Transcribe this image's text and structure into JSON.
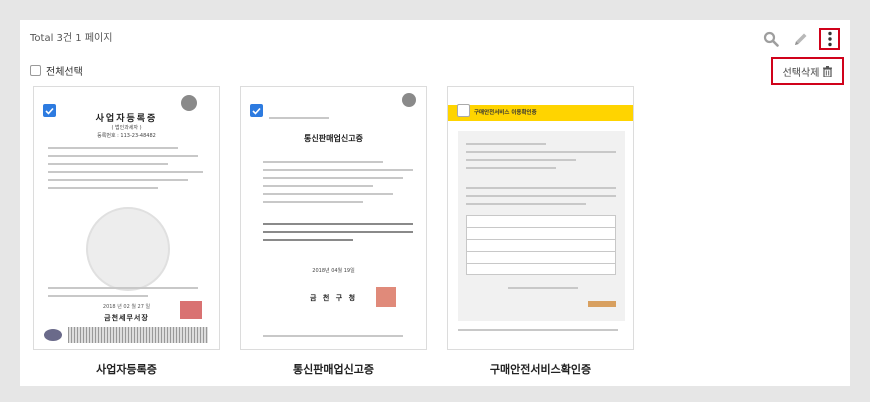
{
  "header": {
    "total_text": "Total 3건 1 페이지",
    "select_all_label": "전체선택",
    "delete_label": "선택삭제"
  },
  "toolbar": {
    "search_icon": "search-icon",
    "edit_icon": "pencil-icon",
    "more_icon": "more-vertical-icon",
    "highlight_color": "#d0021b"
  },
  "documents": [
    {
      "title": "사업자등록증",
      "checked": true,
      "doc_heading": "사업자등록증",
      "doc_sub": "( 법인과세자 )",
      "doc_number": "등록번호 : 113-23-48482",
      "doc_date": "2018 년 02 월 27 일",
      "doc_issuer": "금천세무서장"
    },
    {
      "title": "통신판매업신고증",
      "checked": true,
      "doc_heading": "통신판매업신고증",
      "doc_date": "2018년 04월 19일",
      "doc_issuer": "금 천 구 청"
    },
    {
      "title": "구매안전서비스확인증",
      "checked": false,
      "doc_heading": "구매안전서비스 이용확인증"
    }
  ]
}
